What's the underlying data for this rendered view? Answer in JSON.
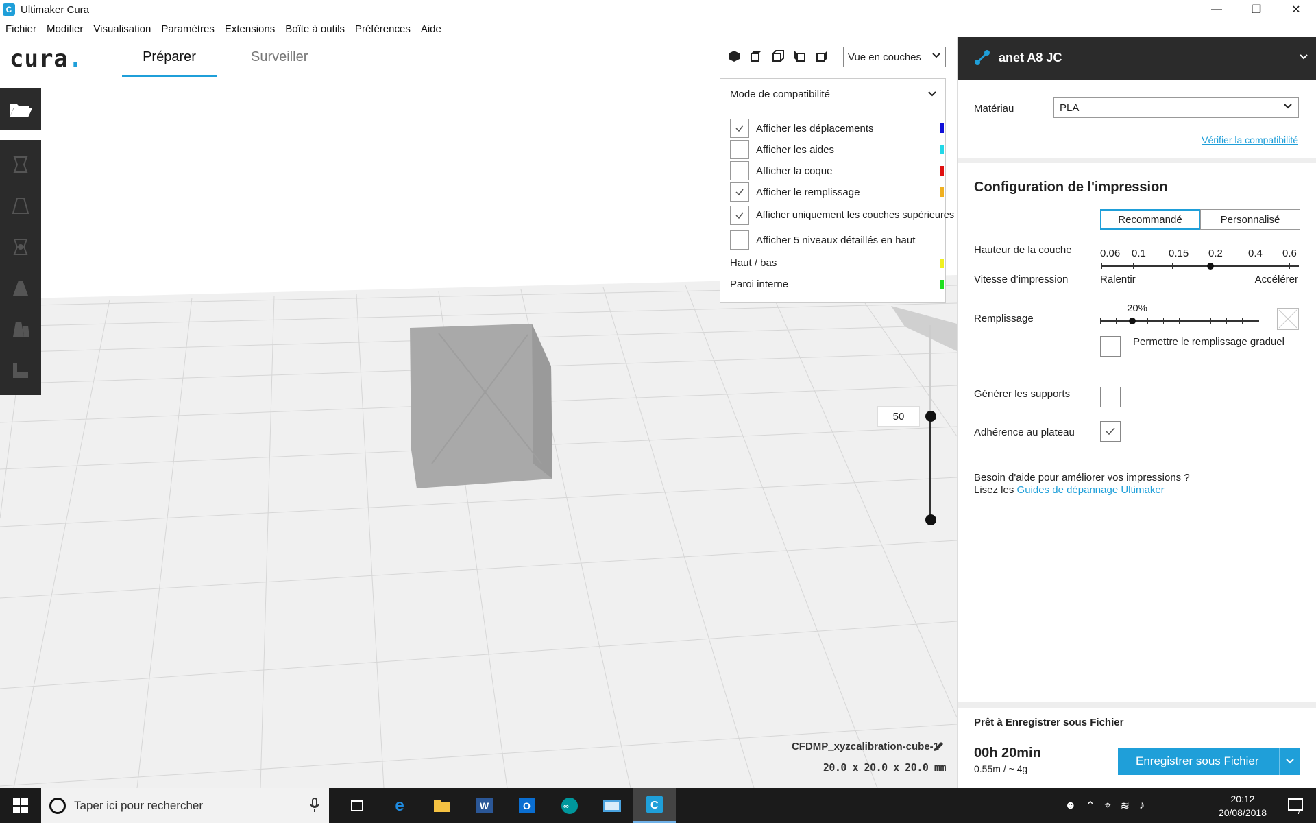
{
  "window": {
    "title": "Ultimaker Cura",
    "app_icon_letter": "C"
  },
  "menu": [
    "Fichier",
    "Modifier",
    "Visualisation",
    "Paramètres",
    "Extensions",
    "Boîte à outils",
    "Préférences",
    "Aide"
  ],
  "header": {
    "logo": "cura",
    "tabs": [
      {
        "label": "Préparer",
        "active": true
      },
      {
        "label": "Surveiller",
        "active": false
      }
    ],
    "view_mode": "Vue en couches"
  },
  "layer_view": {
    "mode": "Mode de compatibilité",
    "options": [
      {
        "label": "Afficher les déplacements",
        "checked": true,
        "color": "#1010d8"
      },
      {
        "label": "Afficher les aides",
        "checked": false,
        "color": "#22d8e8"
      },
      {
        "label": "Afficher la coque",
        "checked": false,
        "color": "#e01010"
      },
      {
        "label": "Afficher le remplissage",
        "checked": true,
        "color": "#f0b020"
      },
      {
        "label": "Afficher uniquement les couches supérieures",
        "checked": true,
        "color": null
      },
      {
        "label": "Afficher 5 niveaux détaillés en haut",
        "checked": false,
        "color": null
      }
    ],
    "legend": [
      {
        "label": "Haut / bas",
        "color": "#f0f020"
      },
      {
        "label": "Paroi interne",
        "color": "#20e020"
      }
    ],
    "layer_value": "50"
  },
  "object": {
    "name": "CFDMP_xyzcalibration-cube-1",
    "dimensions": "20.0 x 20.0 x 20.0 mm"
  },
  "sidebar": {
    "printer": "anet A8 JC",
    "material_label": "Matériau",
    "material": "PLA",
    "compat_link": "Vérifier la compatibilité",
    "config_title": "Configuration de l'impression",
    "mode_recommended": "Recommandé",
    "mode_custom": "Personnalisé",
    "layer_height_label": "Hauteur de la couche",
    "layer_heights": [
      "0.06",
      "0.1",
      "0.15",
      "0.2",
      "0.4",
      "0.6"
    ],
    "layer_height_selected": "0.2",
    "speed_label": "Vitesse d’impression",
    "speed_slow": "Ralentir",
    "speed_fast": "Accélérer",
    "infill_label": "Remplissage",
    "infill_value": "20%",
    "gradual_label": "Permettre le remplissage graduel",
    "gradual_checked": false,
    "supports_label": "Générer les supports",
    "supports_checked": false,
    "adhesion_label": "Adhérence au plateau",
    "adhesion_checked": true,
    "help_line1": "Besoin d'aide pour améliorer vos impressions ?",
    "help_line2_prefix": "Lisez les ",
    "help_link": "Guides de dépannage Ultimaker",
    "ready_label": "Prêt à Enregistrer sous Fichier",
    "print_time": "00h 20min",
    "material_usage": "0.55m / ~ 4g",
    "save_button": "Enregistrer sous Fichier"
  },
  "taskbar": {
    "search_placeholder": "Taper ici pour rechercher",
    "time": "20:12",
    "date": "20/08/2018",
    "notifications": "7"
  }
}
